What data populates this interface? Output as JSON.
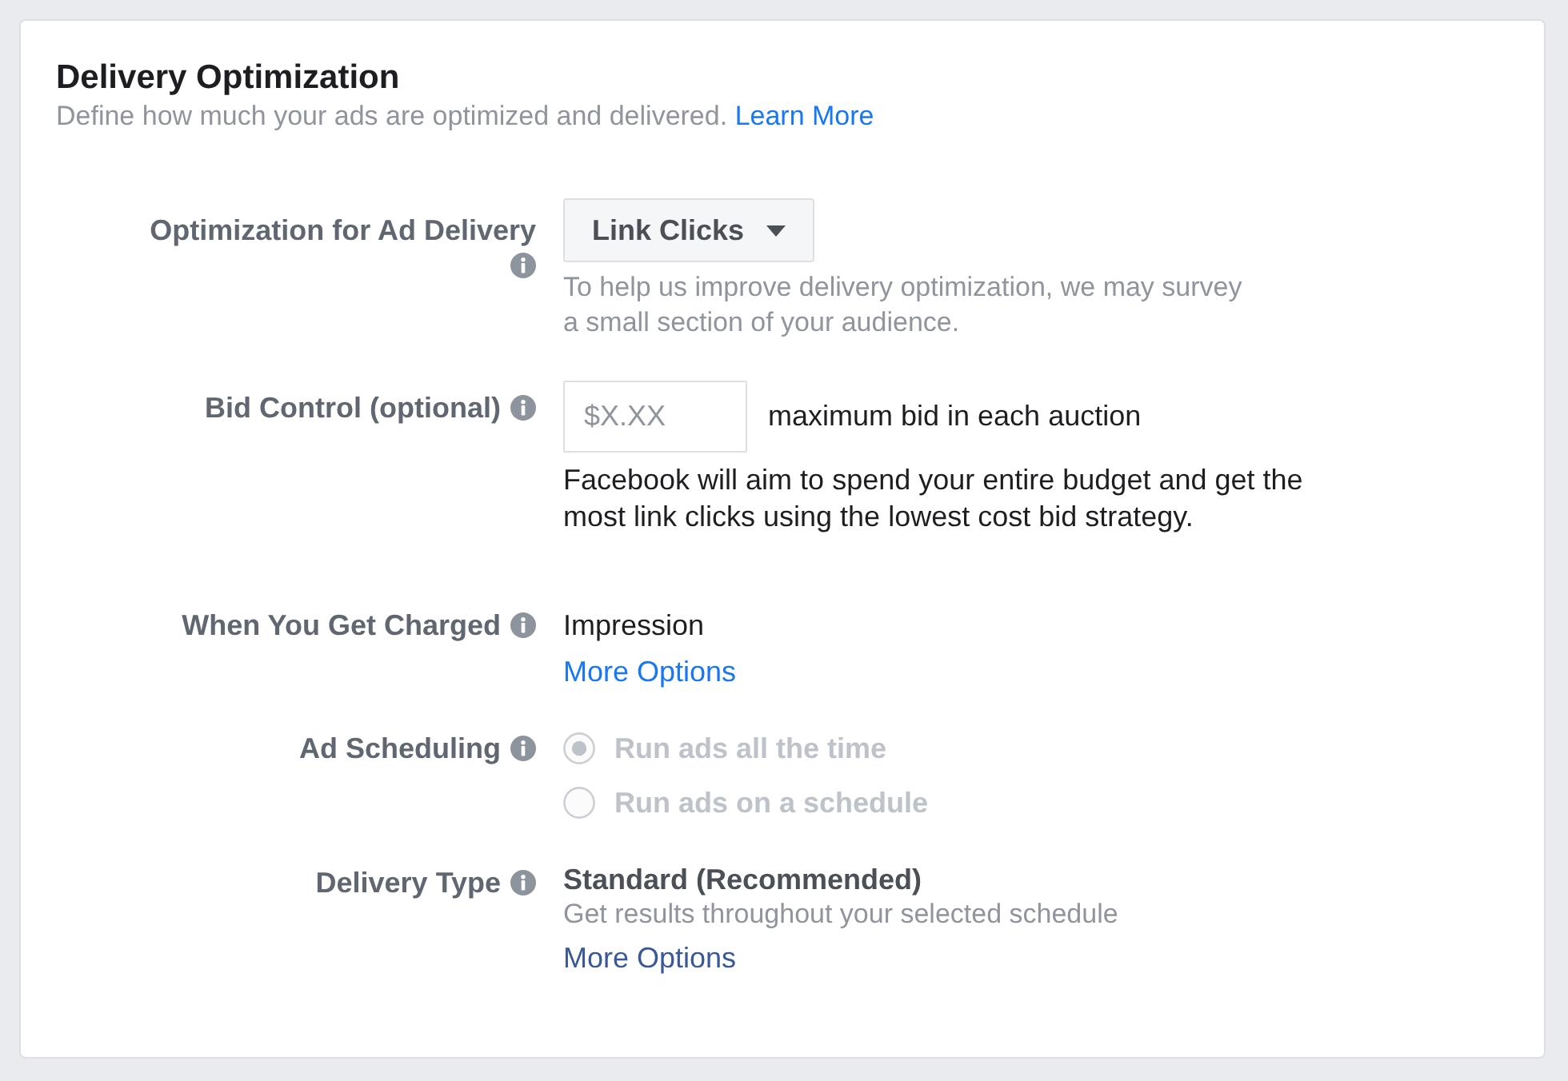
{
  "section": {
    "title": "Delivery Optimization",
    "description": "Define how much your ads are optimized and delivered.",
    "link": {
      "label": "Learn More",
      "visited": false
    }
  },
  "rows": [
    {
      "kind": "dropdown",
      "label": "Optimization for Ad Delivery",
      "value": "Link Clicks",
      "hint": "To help us improve delivery optimization, we may survey a small section of your audience."
    },
    {
      "kind": "bid",
      "label": "Bid Control (optional)",
      "placeholder": "$X.XX",
      "suffix": "maximum bid in each auction",
      "note": "Facebook will aim to spend your entire budget and get the most link clicks using the lowest cost bid strategy."
    },
    {
      "kind": "value",
      "label": "When You Get Charged",
      "value": "Impression",
      "link": {
        "label": "More Options",
        "visited": false
      }
    },
    {
      "kind": "radio",
      "label": "Ad Scheduling",
      "options": [
        {
          "label": "Run ads all the time",
          "selected": true,
          "disabled": true
        },
        {
          "label": "Run ads on a schedule",
          "selected": false,
          "disabled": true
        }
      ]
    },
    {
      "kind": "summary",
      "label": "Delivery Type",
      "value": "Standard (Recommended)",
      "description": "Get results throughout your selected schedule",
      "link": {
        "label": "More Options",
        "visited": true
      }
    }
  ]
}
